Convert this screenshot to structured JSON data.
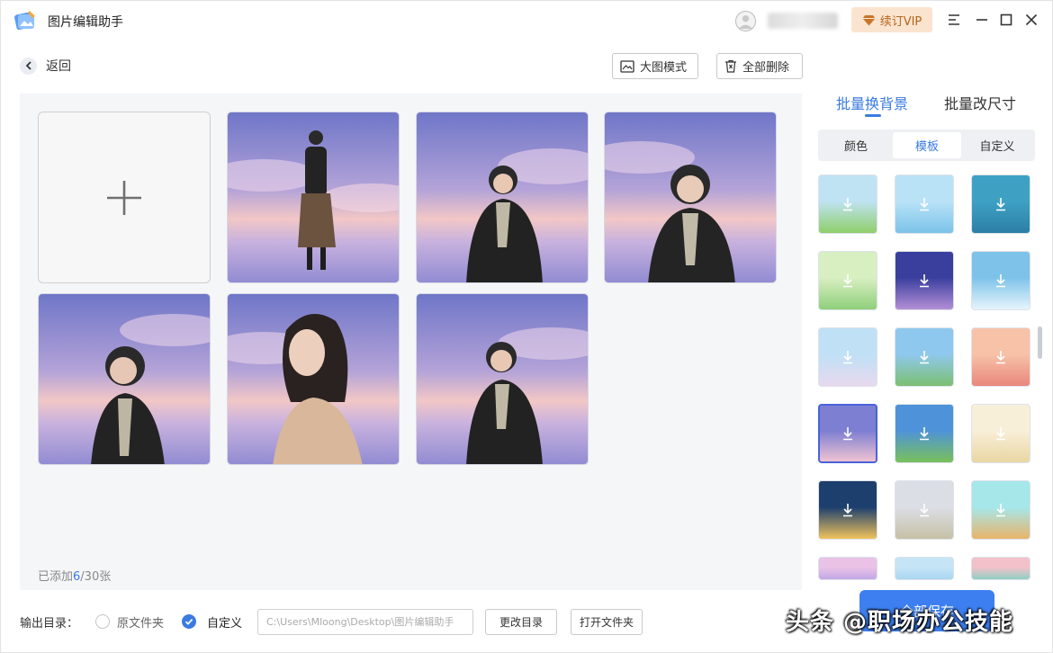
{
  "app": {
    "title": "图片编辑助手"
  },
  "header": {
    "vip_label": "续订VIP"
  },
  "toolbar": {
    "back_label": "返回",
    "large_view_label": "大图模式",
    "delete_all_label": "全部删除"
  },
  "gallery": {
    "added_prefix": "已添加",
    "added_count": "6",
    "added_suffix": "/30张",
    "image_count": 6
  },
  "right_panel": {
    "tabs": [
      "批量换背景",
      "批量改尺寸"
    ],
    "active_tab": 0,
    "segments": [
      "颜色",
      "模板",
      "自定义"
    ],
    "active_segment": 1,
    "templates": [
      "meadow-flowers",
      "kids-picnic",
      "teal-swan",
      "green-leaves",
      "starry-purple-sky",
      "ocean-waves",
      "blue-sky-flowers",
      "house-garden",
      "sunset-boat",
      "purple-cloud-sea",
      "green-field",
      "cream-floral",
      "moon-night",
      "grey-hill",
      "teal-landscape",
      "pink-purple",
      "light-blue",
      "pink-blossom"
    ],
    "selected_template": 9,
    "save_all_label": "全部保存"
  },
  "output": {
    "label": "输出目录：",
    "option_original": "原文件夹",
    "option_custom": "自定义",
    "selected": "custom",
    "path": "C:\\Users\\Mloong\\Desktop\\图片编辑助手",
    "change_dir_label": "更改目录",
    "open_folder_label": "打开文件夹"
  },
  "watermark": "头条 @职场办公技能",
  "colors": {
    "accent": "#3a7be0",
    "vip_bg": "#fbe4cf",
    "vip_text": "#b3651f",
    "canvas_bg": "#f5f6f8"
  }
}
